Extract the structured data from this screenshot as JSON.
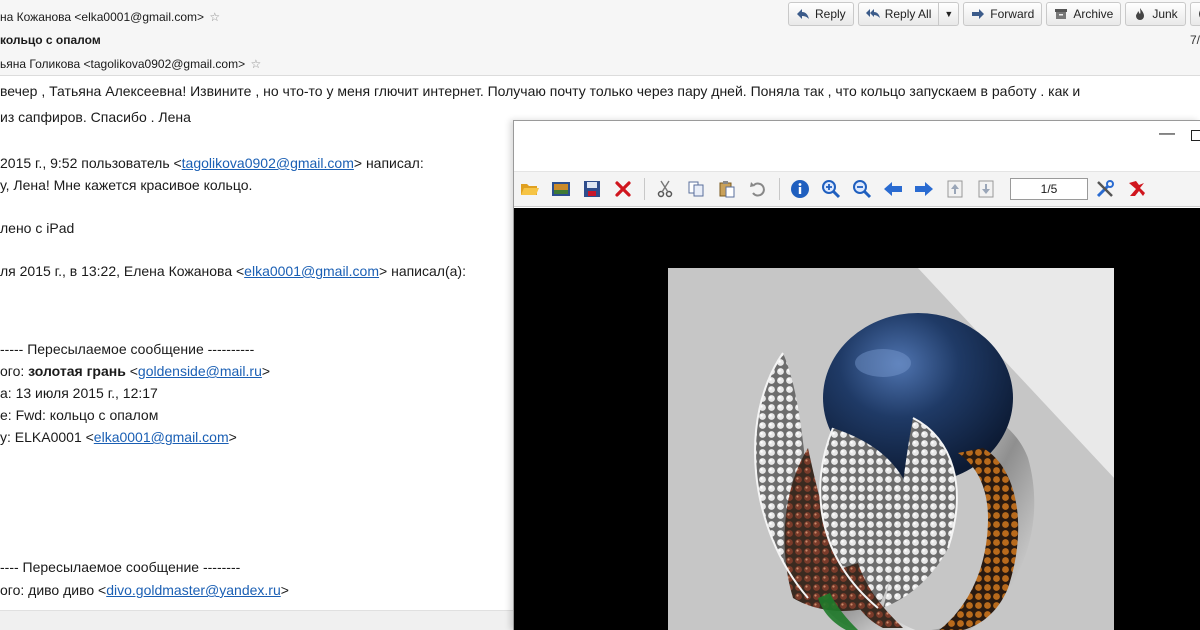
{
  "header": {
    "from": "на Кожанова <elka0001@gmail.com>",
    "subject": "кольцо с опалом",
    "to": "ьяна Голикова <tagolikova0902@gmail.com>",
    "date": "7/",
    "star_icon": "star-outline-icon"
  },
  "toolbar": {
    "reply": "Reply",
    "reply_all": "Reply All",
    "forward": "Forward",
    "archive": "Archive",
    "junk": "Junk",
    "delete": "D"
  },
  "body": {
    "line1": "вечер , Татьяна Алексеевна!  Извините , но что-то у меня глючит интернет. Получаю  почту только через пару дней.  Поняла так , что кольцо запускаем в работу .  как и",
    "line2": " из сапфиров.  Спасибо . Лена",
    "quote1_pre": "2015 г., 9:52 пользователь <",
    "quote1_link": "tagolikova0902@gmail.com",
    "quote1_post": "> написал:",
    "quote1_text": "у, Лена! Мне кажется красивое кольцо.",
    "ipad": "лено с iPad",
    "quote2_pre": "ля 2015 г., в 13:22, Елена Кожанова <",
    "quote2_link": "elka0001@gmail.com",
    "quote2_post": "> написал(а):",
    "fwd1_title": "----- Пересылаемое сообщение ----------",
    "fwd1_from_pre": "ого: ",
    "fwd1_from_bold": "золотая грань",
    "fwd1_from_mid": " <",
    "fwd1_from_link": "goldenside@mail.ru",
    "fwd1_from_post": ">",
    "fwd1_date": "а: 13 июля 2015 г., 12:17",
    "fwd1_subject": "е: Fwd: кольцо с опалом",
    "fwd1_to_pre": "у: ELKA0001 <",
    "fwd1_to_link": "elka0001@gmail.com",
    "fwd1_to_post": ">",
    "fwd2_title": "---- Пересылаемое сообщение --------",
    "fwd2_from_pre": "ого: диво диво <",
    "fwd2_from_link": "divo.goldmaster@yandex.ru",
    "fwd2_from_post": ">"
  },
  "viewer": {
    "minimize_glyph": "—",
    "page_indicator": "1/5",
    "icons": [
      "open-folder-icon",
      "slideshow-icon",
      "save-icon",
      "delete-icon",
      "cut-icon",
      "copy-icon",
      "paste-icon",
      "undo-icon",
      "info-icon",
      "zoom-in-icon",
      "zoom-out-icon",
      "prev-arrow-icon",
      "next-arrow-icon",
      "first-page-icon",
      "last-page-icon",
      "settings-tools-icon",
      "exit-icon"
    ]
  },
  "colors": {
    "link": "#1a5fb4",
    "viewer_canvas": "#000000",
    "sapphire": "#1f3a66"
  }
}
